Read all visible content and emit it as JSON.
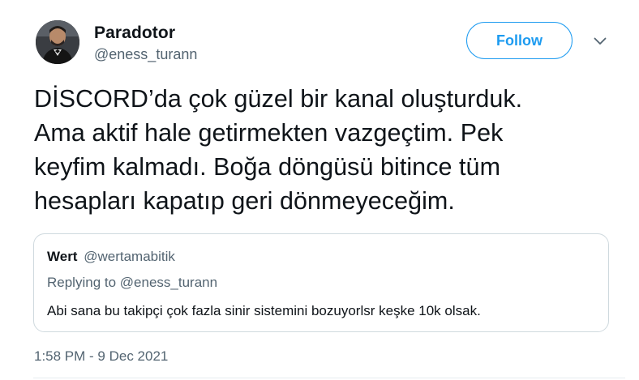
{
  "author": {
    "display_name": "Paradotor",
    "handle": "@eness_turann",
    "avatar_icon": "profile-photo"
  },
  "follow": {
    "label": "Follow",
    "color": "#1d9bf0"
  },
  "menu": {
    "icon": "chevron-down-icon"
  },
  "tweet": {
    "lines": [
      "DİSCORD’da çok güzel bir kanal oluşturduk.",
      "Ama aktif hale getirmekten vazgeçtim. Pek",
      "keyfim kalmadı. Boğa döngüsü bitince tüm",
      "hesapları kapatıp geri dönmeyeceğim."
    ],
    "timestamp": "1:58 PM - 9 Dec 2021"
  },
  "quoted": {
    "name": "Wert",
    "handle": "@wertamabitik",
    "replying_to": "Replying to @eness_turann",
    "text": "Abi sana bu takipçi çok fazla sinir sistemini bozuyorlsr keşke 10k olsak."
  }
}
